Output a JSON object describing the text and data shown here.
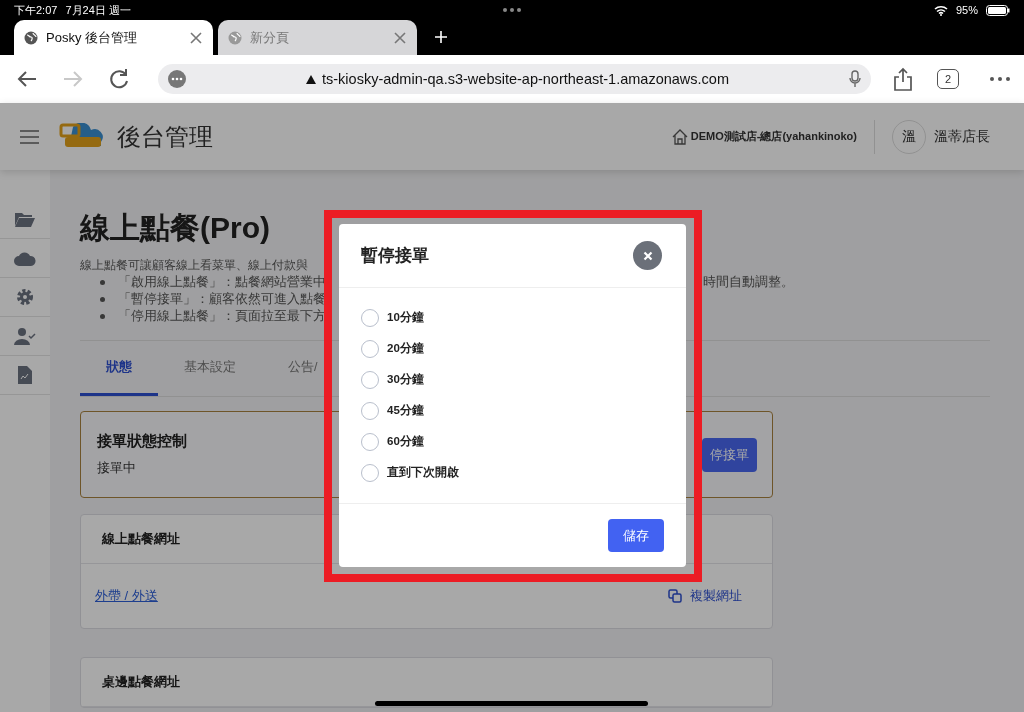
{
  "status_bar": {
    "time": "下午2:07",
    "date": "7月24日 週一",
    "battery": "95%"
  },
  "browser_tabs": [
    {
      "title": "Posky 後台管理",
      "selected": true
    },
    {
      "title": "新分頁",
      "selected": false
    }
  ],
  "address_bar": {
    "url": "ts-kiosky-admin-qa.s3-website-ap-northeast-1.amazonaws.com",
    "can_go_forward": false,
    "tab_count": "2"
  },
  "header": {
    "title": "後台管理",
    "store": "DEMO測試店-總店(yahankinoko)",
    "avatar": "溫",
    "user": "溫蒂店長"
  },
  "page": {
    "title": "線上點餐(Pro)",
    "description": "線上點餐可讓顧客線上看菜單、線上付款與",
    "bullets": [
      {
        "text": "「啟用線上點餐」：點餐網站營業中",
        "text_right": "時間自動調整。"
      },
      {
        "text": "「暫停接單」：顧客依然可進入點餐"
      },
      {
        "text": "「停用線上點餐」：頁面拉至最下方"
      }
    ],
    "tabs": [
      {
        "label": "狀態",
        "selected": true
      },
      {
        "label": "基本設定",
        "selected": false
      },
      {
        "label": "公告/",
        "selected": false
      }
    ],
    "status_card": {
      "title": "接單狀態控制",
      "status": "接單中",
      "button": "停接單"
    },
    "url_cards": [
      {
        "title": "線上點餐網址",
        "link": "外帶 / 外送",
        "copy": "複製網址"
      },
      {
        "title": "桌邊點餐網址"
      }
    ]
  },
  "dialog": {
    "title": "暫停接單",
    "options": [
      {
        "label": "10分鐘",
        "selected": false
      },
      {
        "label": "20分鐘",
        "selected": false
      },
      {
        "label": "30分鐘",
        "selected": false
      },
      {
        "label": "45分鐘",
        "selected": false
      },
      {
        "label": "60分鐘",
        "selected": false
      },
      {
        "label": "直到下次開啟",
        "selected": false
      }
    ],
    "save": "儲存"
  }
}
